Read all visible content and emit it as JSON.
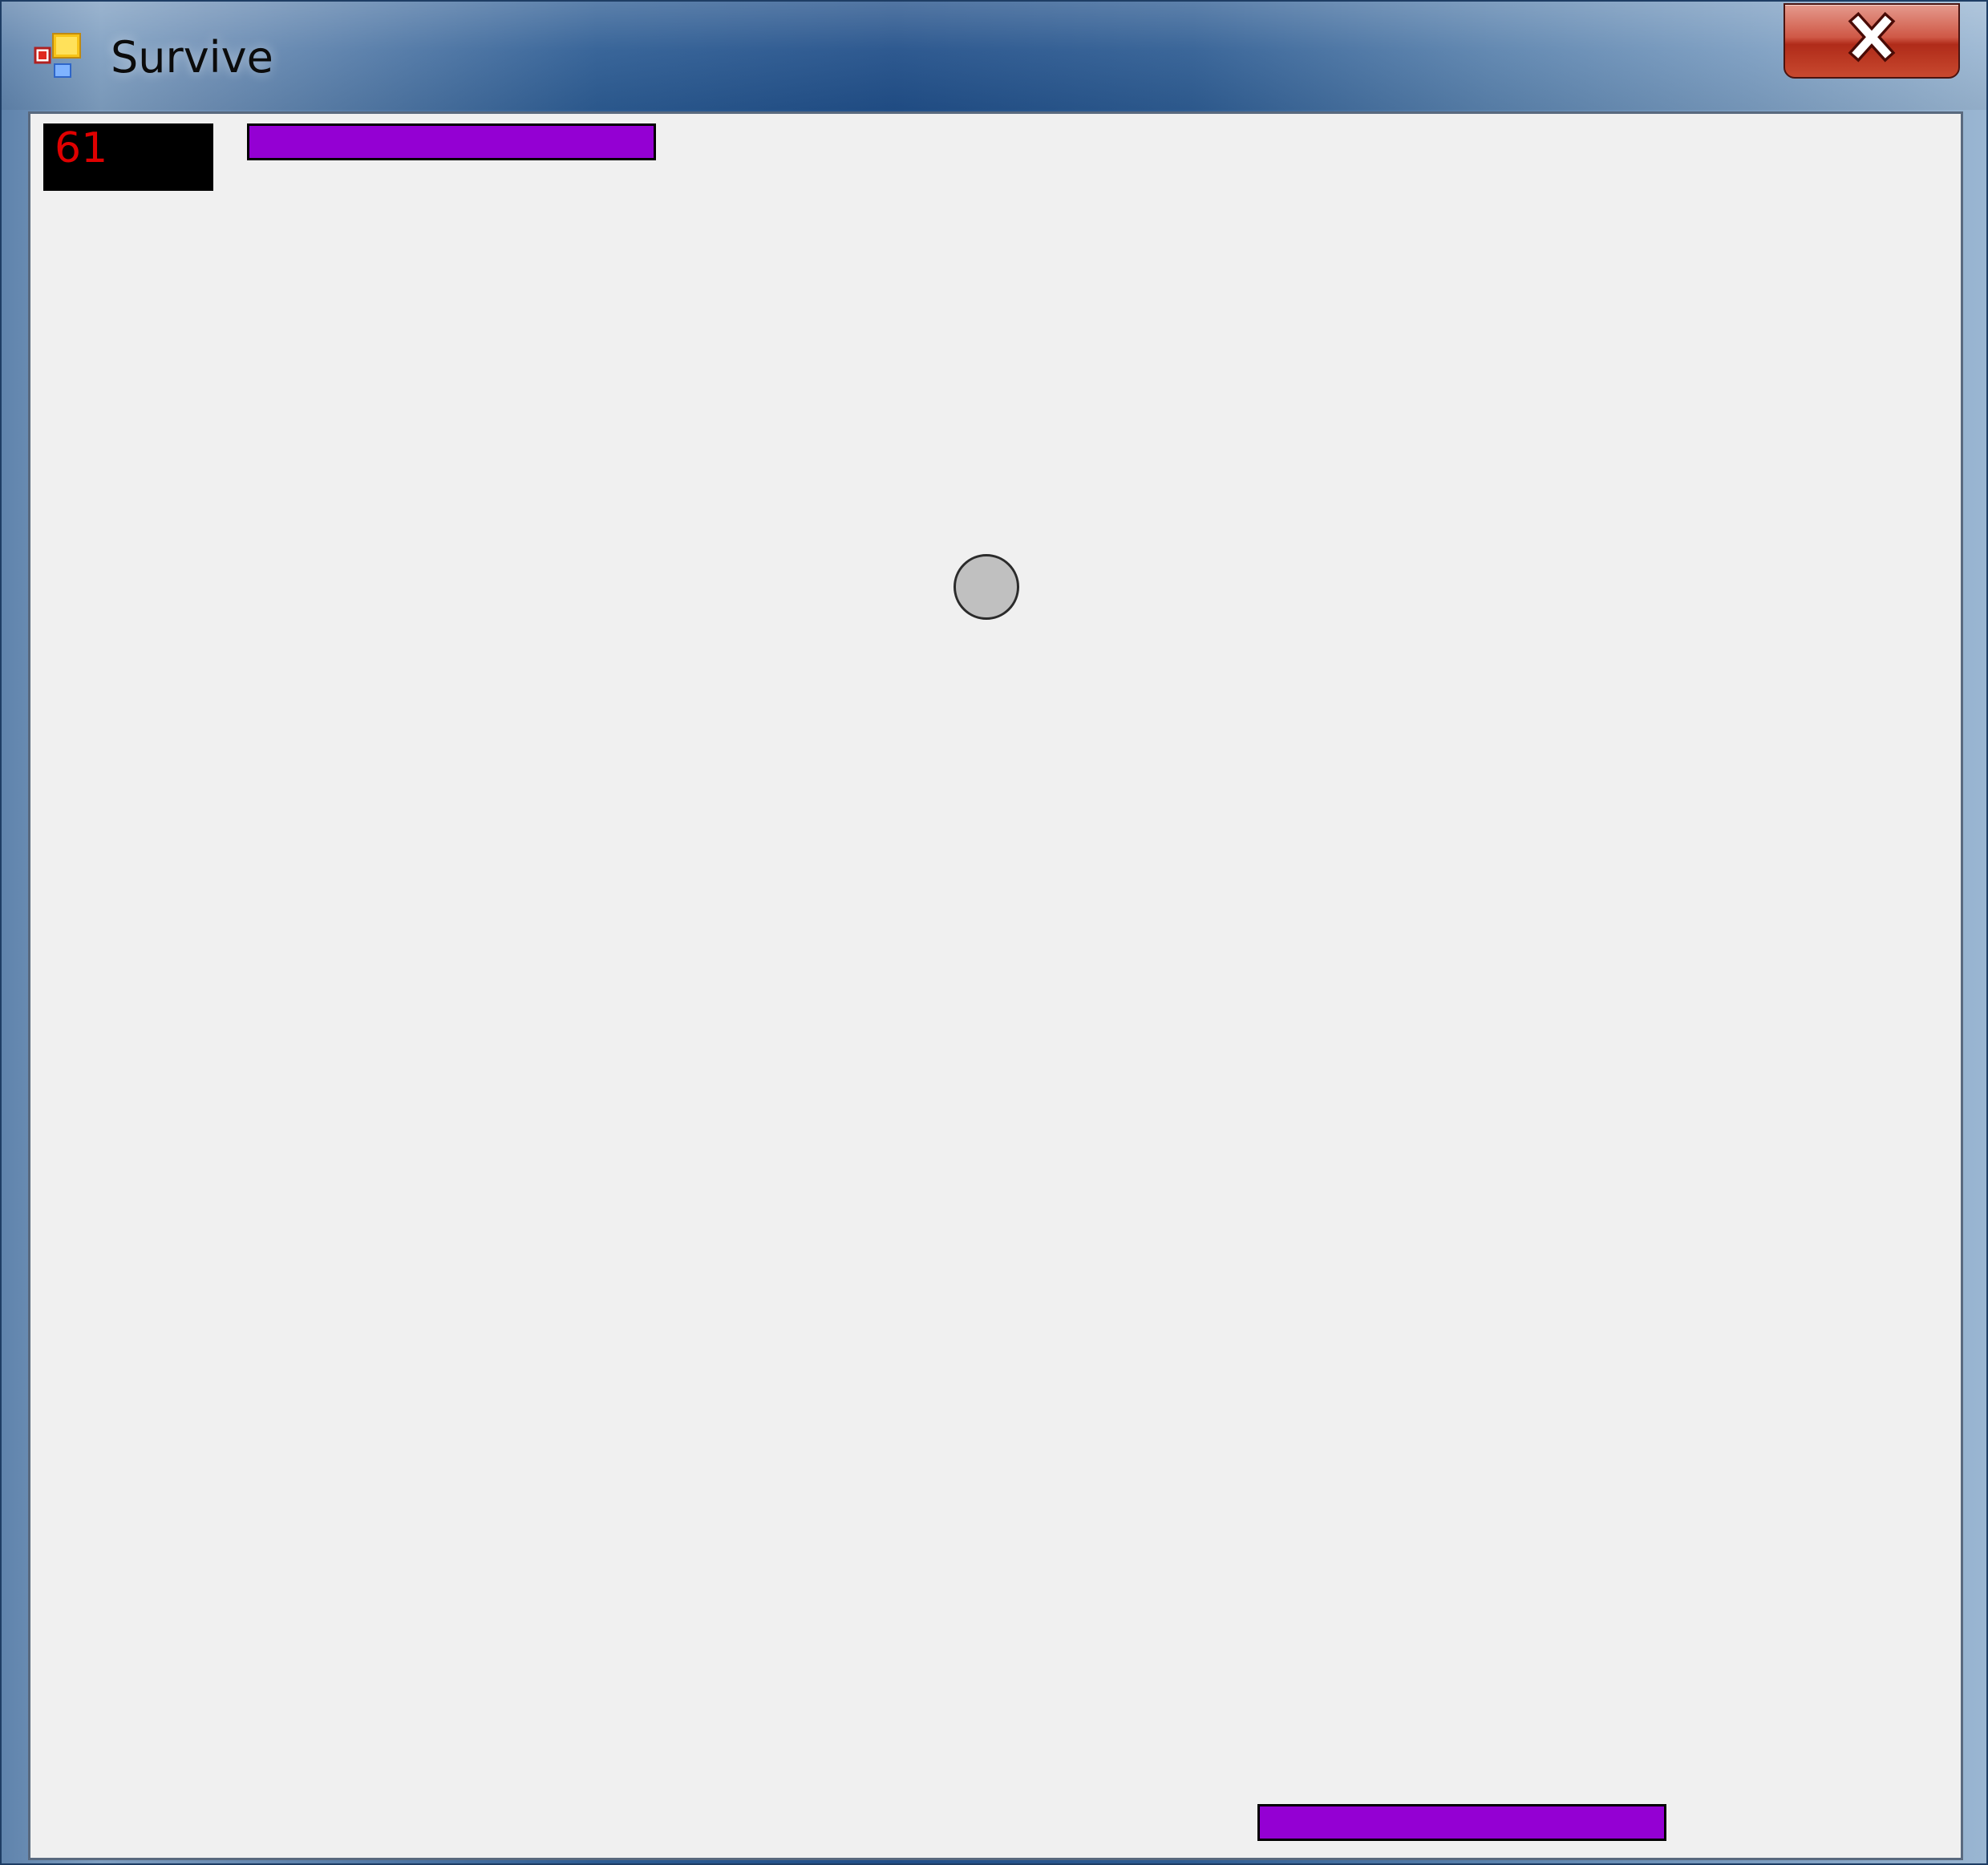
{
  "window": {
    "title": "Survive",
    "icon": "windows-forms-app-icon",
    "close_icon": "close-x-icon"
  },
  "game": {
    "score": "61",
    "colors": {
      "background": "#f0f0f0",
      "score_box": "#000000",
      "score_text": "#e00000",
      "paddle": "#9400d3",
      "ball": "#c0c0c0"
    }
  }
}
